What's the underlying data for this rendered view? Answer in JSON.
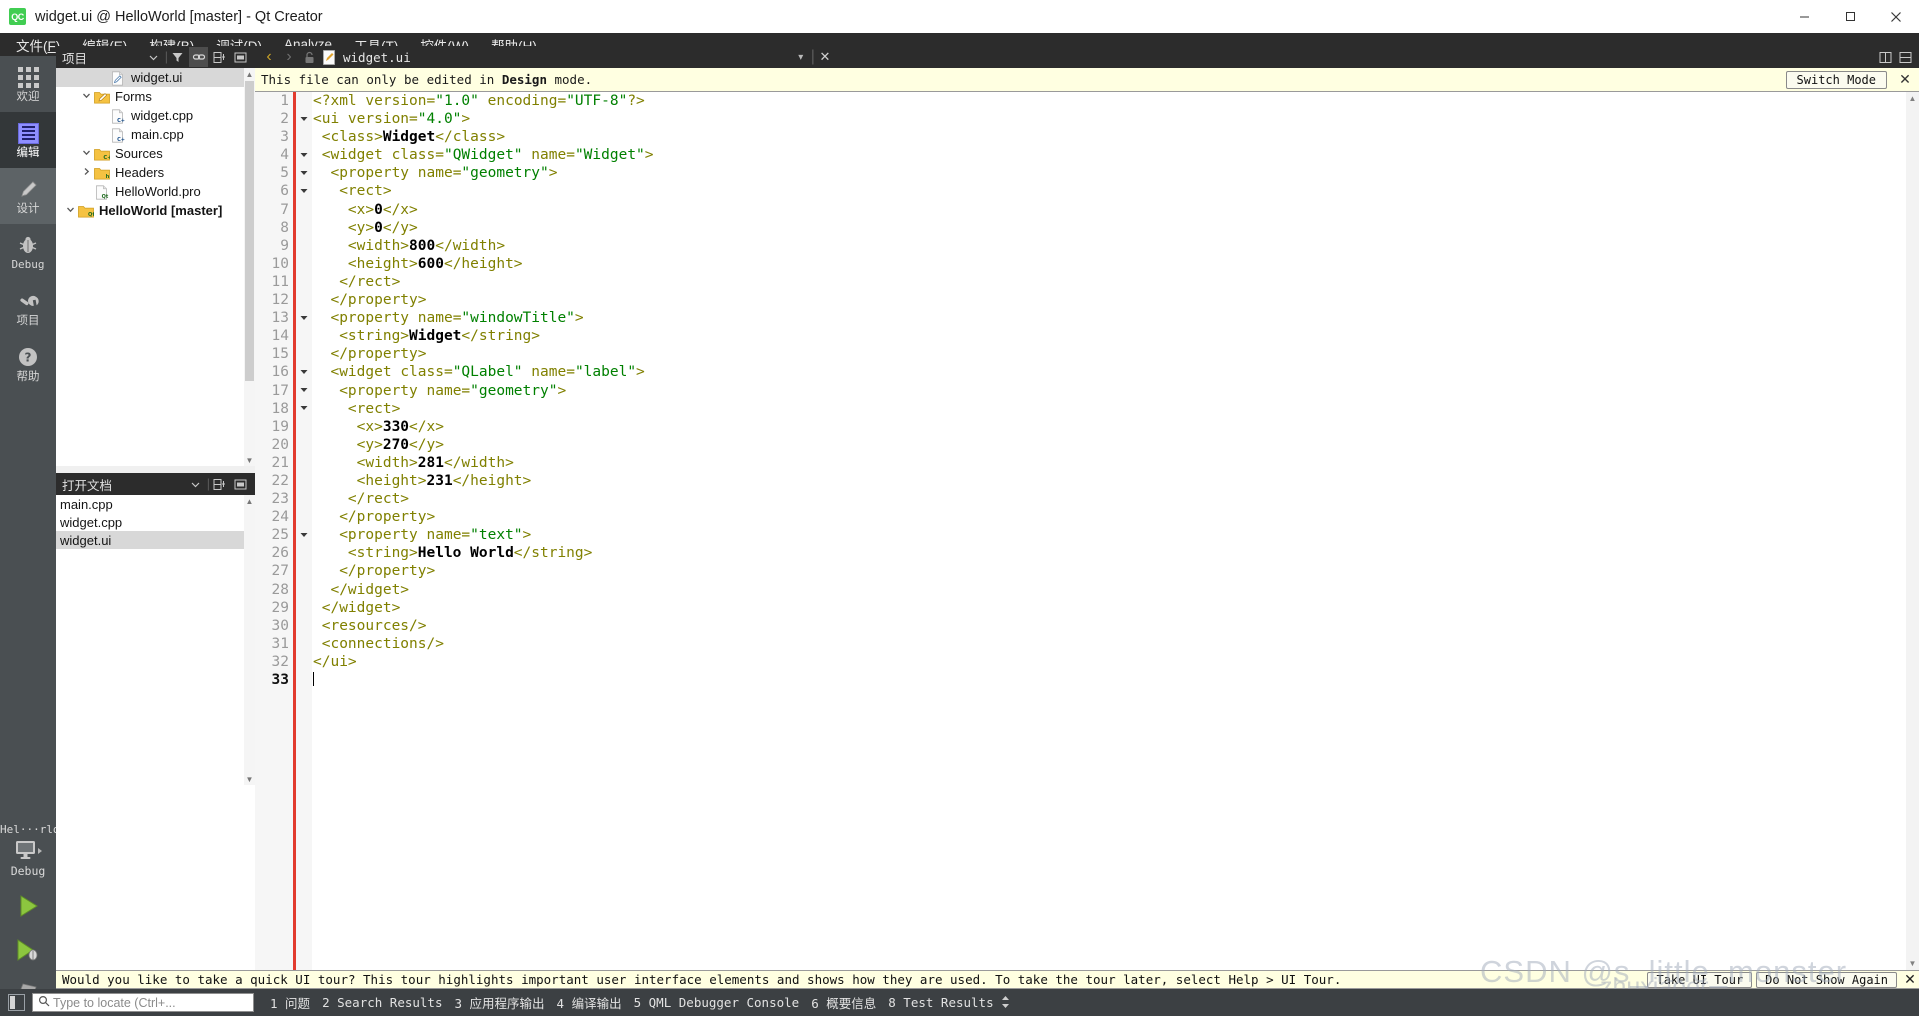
{
  "window": {
    "title": "widget.ui @ HelloWorld [master] - Qt Creator",
    "logo_text": "QC",
    "minimize": "─",
    "maximize": "□",
    "close": "✕"
  },
  "menubar": [
    {
      "pre": "文件(",
      "key": "F",
      "post": ")"
    },
    {
      "pre": "编辑(",
      "key": "E",
      "post": ")"
    },
    {
      "pre": "构建(",
      "key": "B",
      "post": ")"
    },
    {
      "pre": "调试(",
      "key": "D",
      "post": ")"
    },
    {
      "pre": "Analyze",
      "key": "",
      "post": ""
    },
    {
      "pre": "工具(",
      "key": "T",
      "post": ")"
    },
    {
      "pre": "控件(",
      "key": "W",
      "post": ")"
    },
    {
      "pre": "帮助(",
      "key": "H",
      "post": ")"
    }
  ],
  "modebar": {
    "modes": [
      {
        "label": "欢迎",
        "icon": "grid-icon",
        "state": "normal"
      },
      {
        "label": "编辑",
        "icon": "edit-icon",
        "state": "active"
      },
      {
        "label": "设计",
        "icon": "pencil-icon",
        "state": "hover"
      },
      {
        "label": "Debug",
        "icon": "bug-icon",
        "state": "normal"
      },
      {
        "label": "项目",
        "icon": "wrench-icon",
        "state": "normal"
      },
      {
        "label": "帮助",
        "icon": "help-icon",
        "state": "normal"
      }
    ],
    "kit": {
      "name": "Hel···rld",
      "icon": "monitor-icon",
      "build": "Debug"
    },
    "actions": [
      {
        "name": "run-button",
        "icon": "play-icon"
      },
      {
        "name": "debug-button",
        "icon": "play-debug-icon"
      },
      {
        "name": "build-button",
        "icon": "hammer-icon"
      }
    ]
  },
  "project_dock": {
    "title": "项目",
    "header_buttons": [
      "chevron-down-icon",
      "filter-icon",
      "link-icon",
      "split-icon",
      "close-dock-icon"
    ],
    "tree": [
      {
        "label": "HelloWorld [master]",
        "indent": 0,
        "arrow": "⌄",
        "icon": "folder-qt",
        "bold": true,
        "selected": false
      },
      {
        "label": "HelloWorld.pro",
        "indent": 1,
        "arrow": "",
        "icon": "doc-qt",
        "bold": false,
        "selected": false
      },
      {
        "label": "Headers",
        "indent": 1,
        "arrow": "›",
        "icon": "folder-h",
        "bold": false,
        "selected": false
      },
      {
        "label": "Sources",
        "indent": 1,
        "arrow": "⌄",
        "icon": "folder-c",
        "bold": false,
        "selected": false
      },
      {
        "label": "main.cpp",
        "indent": 2,
        "arrow": "",
        "icon": "doc-cpp",
        "bold": false,
        "selected": false
      },
      {
        "label": "widget.cpp",
        "indent": 2,
        "arrow": "",
        "icon": "doc-cpp",
        "bold": false,
        "selected": false
      },
      {
        "label": "Forms",
        "indent": 1,
        "arrow": "⌄",
        "icon": "folder-ui",
        "bold": false,
        "selected": false
      },
      {
        "label": "widget.ui",
        "indent": 2,
        "arrow": "",
        "icon": "doc-ui",
        "bold": false,
        "selected": true
      }
    ]
  },
  "opendocs_dock": {
    "title": "打开文档",
    "header_buttons": [
      "chevron-down-icon",
      "split-icon",
      "close-dock-icon"
    ],
    "items": [
      {
        "label": "main.cpp",
        "selected": false
      },
      {
        "label": "widget.cpp",
        "selected": false
      },
      {
        "label": "widget.ui",
        "selected": true
      }
    ]
  },
  "editor": {
    "toolbar": {
      "back": "‹",
      "forward": "›",
      "lock": "lock-icon",
      "file_icon": "ui-file-icon",
      "filename": "widget.ui",
      "dropdown": "▾",
      "close": "✕",
      "split": "split-icon",
      "split_side": "split-side-icon"
    },
    "banner": {
      "message_pre": "This file can only be edited in ",
      "message_bold": "Design",
      "message_post": " mode.",
      "switch_button": "Switch Mode",
      "close": "✕"
    },
    "cursor_line": 33,
    "lines": [
      {
        "n": 1,
        "fold": "",
        "tokens": [
          {
            "t": "tg",
            "s": "<?xml "
          },
          {
            "t": "at",
            "s": "version"
          },
          {
            "t": "tg",
            "s": "="
          },
          {
            "t": "va",
            "s": "\"1.0\""
          },
          {
            "t": "tg",
            "s": " "
          },
          {
            "t": "at",
            "s": "encoding"
          },
          {
            "t": "tg",
            "s": "="
          },
          {
            "t": "va",
            "s": "\"UTF-8\""
          },
          {
            "t": "tg",
            "s": "?>"
          }
        ]
      },
      {
        "n": 2,
        "fold": "▾",
        "tokens": [
          {
            "t": "tg",
            "s": "<ui "
          },
          {
            "t": "at",
            "s": "version"
          },
          {
            "t": "tg",
            "s": "="
          },
          {
            "t": "va",
            "s": "\"4.0\""
          },
          {
            "t": "tg",
            "s": ">"
          }
        ]
      },
      {
        "n": 3,
        "fold": "",
        "tokens": [
          {
            "t": "tg",
            "s": " <class>"
          },
          {
            "t": "tx",
            "s": "Widget"
          },
          {
            "t": "tg",
            "s": "</class>"
          }
        ]
      },
      {
        "n": 4,
        "fold": "▾",
        "tokens": [
          {
            "t": "tg",
            "s": " <widget "
          },
          {
            "t": "at",
            "s": "class"
          },
          {
            "t": "tg",
            "s": "="
          },
          {
            "t": "va",
            "s": "\"QWidget\""
          },
          {
            "t": "tg",
            "s": " "
          },
          {
            "t": "at",
            "s": "name"
          },
          {
            "t": "tg",
            "s": "="
          },
          {
            "t": "va",
            "s": "\"Widget\""
          },
          {
            "t": "tg",
            "s": ">"
          }
        ]
      },
      {
        "n": 5,
        "fold": "▾",
        "tokens": [
          {
            "t": "tg",
            "s": "  <property "
          },
          {
            "t": "at",
            "s": "name"
          },
          {
            "t": "tg",
            "s": "="
          },
          {
            "t": "va",
            "s": "\"geometry\""
          },
          {
            "t": "tg",
            "s": ">"
          }
        ]
      },
      {
        "n": 6,
        "fold": "▾",
        "tokens": [
          {
            "t": "tg",
            "s": "   <rect>"
          }
        ]
      },
      {
        "n": 7,
        "fold": "",
        "tokens": [
          {
            "t": "tg",
            "s": "    <x>"
          },
          {
            "t": "tx",
            "s": "0"
          },
          {
            "t": "tg",
            "s": "</x>"
          }
        ]
      },
      {
        "n": 8,
        "fold": "",
        "tokens": [
          {
            "t": "tg",
            "s": "    <y>"
          },
          {
            "t": "tx",
            "s": "0"
          },
          {
            "t": "tg",
            "s": "</y>"
          }
        ]
      },
      {
        "n": 9,
        "fold": "",
        "tokens": [
          {
            "t": "tg",
            "s": "    <width>"
          },
          {
            "t": "tx",
            "s": "800"
          },
          {
            "t": "tg",
            "s": "</width>"
          }
        ]
      },
      {
        "n": 10,
        "fold": "",
        "tokens": [
          {
            "t": "tg",
            "s": "    <height>"
          },
          {
            "t": "tx",
            "s": "600"
          },
          {
            "t": "tg",
            "s": "</height>"
          }
        ]
      },
      {
        "n": 11,
        "fold": "",
        "tokens": [
          {
            "t": "tg",
            "s": "   </rect>"
          }
        ]
      },
      {
        "n": 12,
        "fold": "",
        "tokens": [
          {
            "t": "tg",
            "s": "  </property>"
          }
        ]
      },
      {
        "n": 13,
        "fold": "▾",
        "tokens": [
          {
            "t": "tg",
            "s": "  <property "
          },
          {
            "t": "at",
            "s": "name"
          },
          {
            "t": "tg",
            "s": "="
          },
          {
            "t": "va",
            "s": "\"windowTitle\""
          },
          {
            "t": "tg",
            "s": ">"
          }
        ]
      },
      {
        "n": 14,
        "fold": "",
        "tokens": [
          {
            "t": "tg",
            "s": "   <string>"
          },
          {
            "t": "tx",
            "s": "Widget"
          },
          {
            "t": "tg",
            "s": "</string>"
          }
        ]
      },
      {
        "n": 15,
        "fold": "",
        "tokens": [
          {
            "t": "tg",
            "s": "  </property>"
          }
        ]
      },
      {
        "n": 16,
        "fold": "▾",
        "tokens": [
          {
            "t": "tg",
            "s": "  <widget "
          },
          {
            "t": "at",
            "s": "class"
          },
          {
            "t": "tg",
            "s": "="
          },
          {
            "t": "va",
            "s": "\"QLabel\""
          },
          {
            "t": "tg",
            "s": " "
          },
          {
            "t": "at",
            "s": "name"
          },
          {
            "t": "tg",
            "s": "="
          },
          {
            "t": "va",
            "s": "\"label\""
          },
          {
            "t": "tg",
            "s": ">"
          }
        ]
      },
      {
        "n": 17,
        "fold": "▾",
        "tokens": [
          {
            "t": "tg",
            "s": "   <property "
          },
          {
            "t": "at",
            "s": "name"
          },
          {
            "t": "tg",
            "s": "="
          },
          {
            "t": "va",
            "s": "\"geometry\""
          },
          {
            "t": "tg",
            "s": ">"
          }
        ]
      },
      {
        "n": 18,
        "fold": "▾",
        "tokens": [
          {
            "t": "tg",
            "s": "    <rect>"
          }
        ]
      },
      {
        "n": 19,
        "fold": "",
        "tokens": [
          {
            "t": "tg",
            "s": "     <x>"
          },
          {
            "t": "tx",
            "s": "330"
          },
          {
            "t": "tg",
            "s": "</x>"
          }
        ]
      },
      {
        "n": 20,
        "fold": "",
        "tokens": [
          {
            "t": "tg",
            "s": "     <y>"
          },
          {
            "t": "tx",
            "s": "270"
          },
          {
            "t": "tg",
            "s": "</y>"
          }
        ]
      },
      {
        "n": 21,
        "fold": "",
        "tokens": [
          {
            "t": "tg",
            "s": "     <width>"
          },
          {
            "t": "tx",
            "s": "281"
          },
          {
            "t": "tg",
            "s": "</width>"
          }
        ]
      },
      {
        "n": 22,
        "fold": "",
        "tokens": [
          {
            "t": "tg",
            "s": "     <height>"
          },
          {
            "t": "tx",
            "s": "231"
          },
          {
            "t": "tg",
            "s": "</height>"
          }
        ]
      },
      {
        "n": 23,
        "fold": "",
        "tokens": [
          {
            "t": "tg",
            "s": "    </rect>"
          }
        ]
      },
      {
        "n": 24,
        "fold": "",
        "tokens": [
          {
            "t": "tg",
            "s": "   </property>"
          }
        ]
      },
      {
        "n": 25,
        "fold": "▾",
        "tokens": [
          {
            "t": "tg",
            "s": "   <property "
          },
          {
            "t": "at",
            "s": "name"
          },
          {
            "t": "tg",
            "s": "="
          },
          {
            "t": "va",
            "s": "\"text\""
          },
          {
            "t": "tg",
            "s": ">"
          }
        ]
      },
      {
        "n": 26,
        "fold": "",
        "tokens": [
          {
            "t": "tg",
            "s": "    <string>"
          },
          {
            "t": "tx",
            "s": "Hello World"
          },
          {
            "t": "tg",
            "s": "</string>"
          }
        ]
      },
      {
        "n": 27,
        "fold": "",
        "tokens": [
          {
            "t": "tg",
            "s": "   </property>"
          }
        ]
      },
      {
        "n": 28,
        "fold": "",
        "tokens": [
          {
            "t": "tg",
            "s": "  </widget>"
          }
        ]
      },
      {
        "n": 29,
        "fold": "",
        "tokens": [
          {
            "t": "tg",
            "s": " </widget>"
          }
        ]
      },
      {
        "n": 30,
        "fold": "",
        "tokens": [
          {
            "t": "tg",
            "s": " <resources/>"
          }
        ]
      },
      {
        "n": 31,
        "fold": "",
        "tokens": [
          {
            "t": "tg",
            "s": " <connections/>"
          }
        ]
      },
      {
        "n": 32,
        "fold": "",
        "tokens": [
          {
            "t": "tg",
            "s": "</ui>"
          }
        ]
      },
      {
        "n": 33,
        "fold": "",
        "tokens": []
      }
    ]
  },
  "tour": {
    "message": "Would you like to take a quick UI tour? This tour highlights important user interface elements and shows how they are used. To take the tour later, select Help > UI Tour.",
    "take_button": "Take UI Tour",
    "dismiss_button": "Do Not Show Again",
    "close": "✕"
  },
  "watermark": {
    "line1": "CSDN @s_little_monster",
    "line2": "zhuxiaoer"
  },
  "statusbar": {
    "toggle_sidebar": "sidebar-toggle-icon",
    "locator_placeholder": "Type to locate (Ctrl+...",
    "search_icon": "search-icon",
    "panes": [
      "1 问题",
      "2 Search Results",
      "3 应用程序输出",
      "4 编译输出",
      "5 QML Debugger Console",
      "6 概要信息",
      "8 Test Results"
    ],
    "updown": "⇅"
  },
  "colors": {
    "accent_green": "#41cd52",
    "mode_active_bg": "#333739",
    "banner_bg": "#ffffe1",
    "selection": "#d8d8d8",
    "tag": "#808000",
    "value": "#008000"
  }
}
